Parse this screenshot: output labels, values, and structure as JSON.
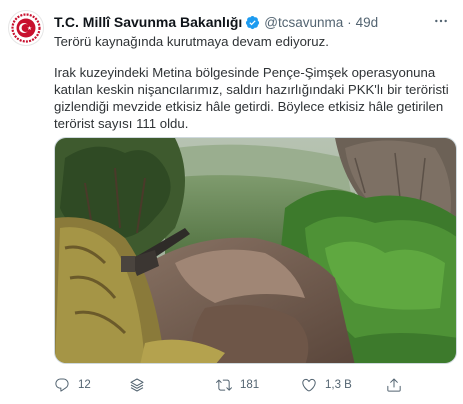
{
  "author": {
    "name": "T.C. Millî Savunma Bakanlığı",
    "handle": "@tcsavunma",
    "separator": "·",
    "time": "49d",
    "verified": true
  },
  "tweet": {
    "line1": "Terörü kaynağında kurutmaya devam ediyoruz.",
    "line2": "Irak kuzeyindeki Metina bölgesinde Pençe-Şimşek operasyonuna katılan keskin nişancılarımız, saldırı hazırlığındaki PKK'lı bir teröristi gizlendiği mevzide etkisiz hâle getirdi. Böylece etkisiz hâle getirilen terörist sayısı 111 oldu."
  },
  "actions": {
    "replies": "12",
    "retweets": "181",
    "likes": "1,3 B"
  },
  "icons": {
    "avatar": "ministry-seal-icon",
    "verified": "verified-badge-icon",
    "more": "more-options-icon",
    "reply": "reply-icon",
    "stack": "stack-icon",
    "retweet": "retweet-icon",
    "like": "heart-icon",
    "share": "share-icon"
  },
  "colors": {
    "brand_red": "#c8102e",
    "verified_blue": "#1d9bf0",
    "muted": "#536471"
  }
}
